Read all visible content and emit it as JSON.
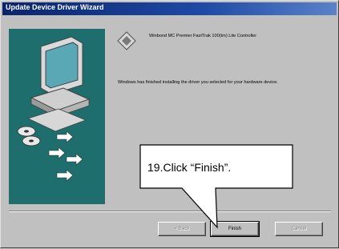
{
  "window": {
    "title": "Update Device Driver Wizard"
  },
  "wizard": {
    "device_name": "Winbond MC Premier FastTrak 100(tm) Lite Controller",
    "finish_message": "Windows has finished installing the driver you selected for your hardware device."
  },
  "buttons": {
    "back_label": "< Back",
    "finish_label": "Finish",
    "cancel_label": "Cancel"
  },
  "annotation": {
    "text": "19.Click “Finish”."
  },
  "colors": {
    "title_bar": "#0a246a",
    "dialog_bg": "#c0c0c0",
    "art_panel": "#1f6e6e",
    "annotation_bg": "#ffffff"
  },
  "icons": {
    "device": "device-diamond-icon",
    "computer": "computer-icon",
    "disk": "disk-icon",
    "arrow": "arrow-icon"
  }
}
